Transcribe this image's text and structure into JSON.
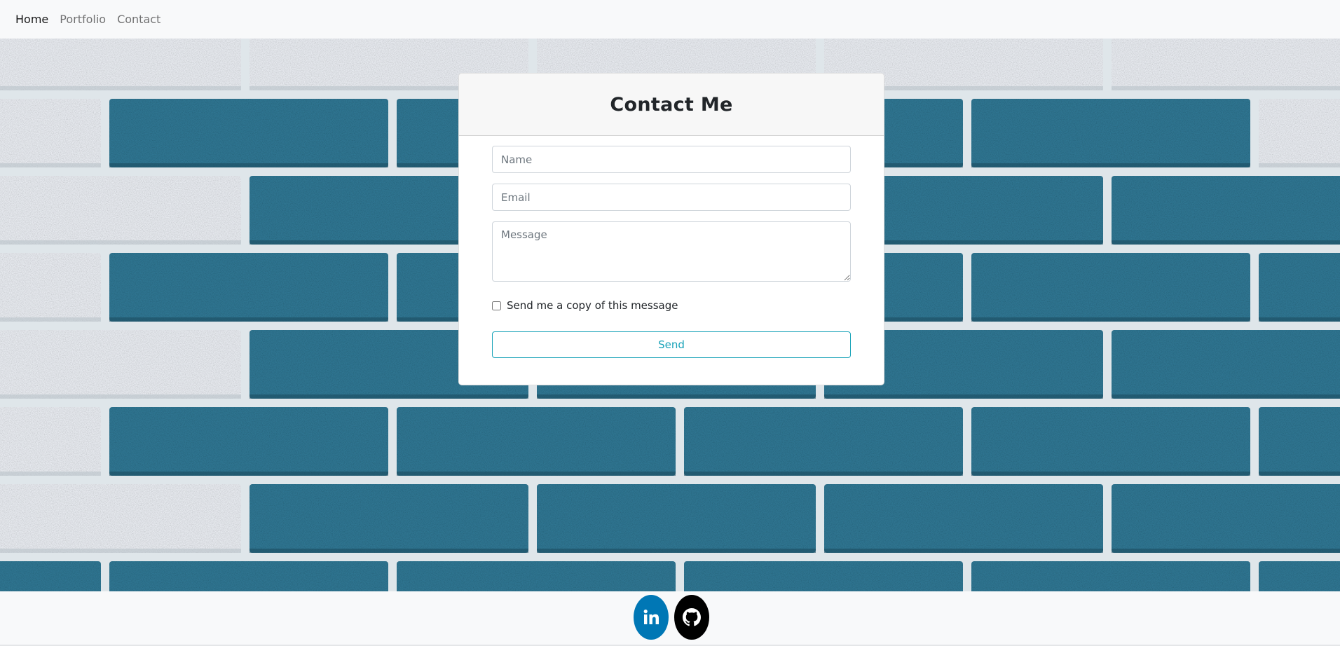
{
  "nav": {
    "items": [
      {
        "label": "Home",
        "active": true
      },
      {
        "label": "Portfolio",
        "active": false
      },
      {
        "label": "Contact",
        "active": false
      }
    ]
  },
  "contact_card": {
    "title": "Contact Me",
    "name_placeholder": "Name",
    "email_placeholder": "Email",
    "message_placeholder": "Message",
    "copy_checkbox_label": "Send me a copy of this message",
    "copy_checked": false,
    "send_label": "Send"
  },
  "footer": {
    "social": [
      {
        "name": "linkedin-icon",
        "color": "#0077b5"
      },
      {
        "name": "github-icon",
        "color": "#000000"
      }
    ]
  },
  "colors": {
    "accent": "#17a2b8",
    "brick_blue": "#2f7591",
    "brick_white": "#e6e9ee",
    "nav_bg": "#f8f9fa"
  }
}
